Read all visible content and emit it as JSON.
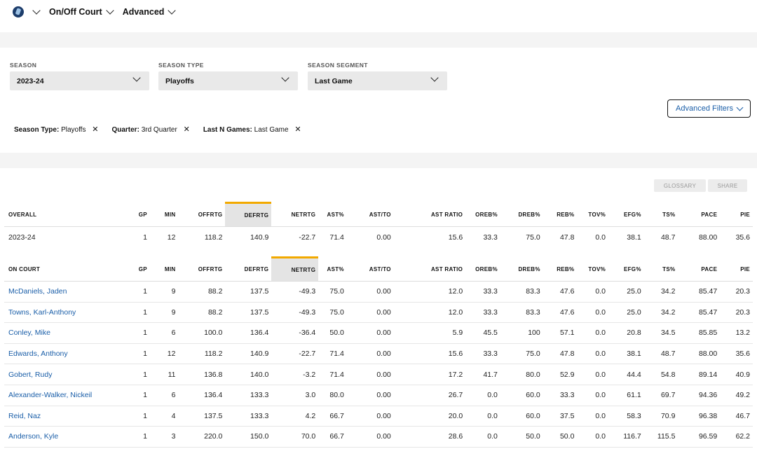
{
  "topbar": {
    "icon": "team-logo-icon",
    "dropdown_view": "On/Off Court",
    "dropdown_mode": "Advanced"
  },
  "filters": {
    "season": {
      "label": "SEASON",
      "value": "2023-24"
    },
    "season_type": {
      "label": "SEASON TYPE",
      "value": "Playoffs"
    },
    "season_segment": {
      "label": "SEASON SEGMENT",
      "value": "Last Game"
    },
    "advanced_filters_label": "Advanced Filters"
  },
  "active_filters": [
    {
      "key": "Season Type:",
      "value": "Playoffs"
    },
    {
      "key": "Quarter:",
      "value": "3rd Quarter"
    },
    {
      "key": "Last N Games:",
      "value": "Last Game"
    }
  ],
  "actions": {
    "glossary": "GLOSSARY",
    "share": "SHARE"
  },
  "colors": {
    "link": "#1a5ea8",
    "sort_accent": "#f2a900"
  },
  "overall": {
    "headers": [
      "OVERALL",
      "GP",
      "MIN",
      "OFFRTG",
      "DEFRTG",
      "NETRTG",
      "AST%",
      "AST/TO",
      "AST RATIO",
      "OREB%",
      "DREB%",
      "REB%",
      "TOV%",
      "EFG%",
      "TS%",
      "PACE",
      "PIE"
    ],
    "sorted_column": "DEFRTG",
    "rows": [
      [
        "2023-24",
        "1",
        "12",
        "118.2",
        "140.9",
        "-22.7",
        "71.4",
        "0.00",
        "15.6",
        "33.3",
        "75.0",
        "47.8",
        "0.0",
        "38.1",
        "48.7",
        "88.00",
        "35.6"
      ]
    ]
  },
  "on_court": {
    "headers": [
      "ON COURT",
      "GP",
      "MIN",
      "OFFRTG",
      "DEFRTG",
      "NETRTG",
      "AST%",
      "AST/TO",
      "AST RATIO",
      "OREB%",
      "DREB%",
      "REB%",
      "TOV%",
      "EFG%",
      "TS%",
      "PACE",
      "PIE"
    ],
    "sorted_column": "NETRTG",
    "rows": [
      [
        "McDaniels, Jaden",
        "1",
        "9",
        "88.2",
        "137.5",
        "-49.3",
        "75.0",
        "0.00",
        "12.0",
        "33.3",
        "83.3",
        "47.6",
        "0.0",
        "25.0",
        "34.2",
        "85.47",
        "20.3"
      ],
      [
        "Towns, Karl-Anthony",
        "1",
        "9",
        "88.2",
        "137.5",
        "-49.3",
        "75.0",
        "0.00",
        "12.0",
        "33.3",
        "83.3",
        "47.6",
        "0.0",
        "25.0",
        "34.2",
        "85.47",
        "20.3"
      ],
      [
        "Conley, Mike",
        "1",
        "6",
        "100.0",
        "136.4",
        "-36.4",
        "50.0",
        "0.00",
        "5.9",
        "45.5",
        "100",
        "57.1",
        "0.0",
        "20.8",
        "34.5",
        "85.85",
        "13.2"
      ],
      [
        "Edwards, Anthony",
        "1",
        "12",
        "118.2",
        "140.9",
        "-22.7",
        "71.4",
        "0.00",
        "15.6",
        "33.3",
        "75.0",
        "47.8",
        "0.0",
        "38.1",
        "48.7",
        "88.00",
        "35.6"
      ],
      [
        "Gobert, Rudy",
        "1",
        "11",
        "136.8",
        "140.0",
        "-3.2",
        "71.4",
        "0.00",
        "17.2",
        "41.7",
        "80.0",
        "52.9",
        "0.0",
        "44.4",
        "54.8",
        "89.14",
        "40.9"
      ],
      [
        "Alexander-Walker, Nickeil",
        "1",
        "6",
        "136.4",
        "133.3",
        "3.0",
        "80.0",
        "0.00",
        "26.7",
        "0.0",
        "60.0",
        "33.3",
        "0.0",
        "61.1",
        "69.7",
        "94.36",
        "49.2"
      ],
      [
        "Reid, Naz",
        "1",
        "4",
        "137.5",
        "133.3",
        "4.2",
        "66.7",
        "0.00",
        "20.0",
        "0.0",
        "60.0",
        "37.5",
        "0.0",
        "58.3",
        "70.9",
        "96.38",
        "46.7"
      ],
      [
        "Anderson, Kyle",
        "1",
        "3",
        "220.0",
        "150.0",
        "70.0",
        "66.7",
        "0.00",
        "28.6",
        "0.0",
        "50.0",
        "50.0",
        "0.0",
        "116.7",
        "115.5",
        "96.59",
        "62.2"
      ]
    ]
  }
}
